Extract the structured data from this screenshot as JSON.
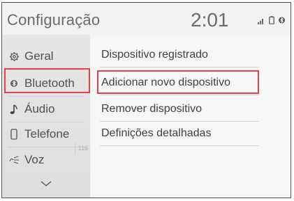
{
  "header": {
    "title": "Configuração",
    "clock": "2:01",
    "status_icons": [
      "signal-icon",
      "battery-icon",
      "bluetooth-status-icon"
    ]
  },
  "sidebar": {
    "items": [
      {
        "label": "Geral",
        "icon": "gear-icon"
      },
      {
        "label": "Bluetooth",
        "icon": "bluetooth-icon",
        "selected": true
      },
      {
        "label": "Áudio",
        "icon": "music-note-icon"
      },
      {
        "label": "Telefone",
        "icon": "phone-icon"
      },
      {
        "label": "Voz",
        "icon": "voice-icon"
      }
    ],
    "badge": "116",
    "more_icon": "chevron-down-icon"
  },
  "main": {
    "items": [
      {
        "label": "Dispositivo registrado"
      },
      {
        "label": "Adicionar novo dispositivo",
        "highlighted": true
      },
      {
        "label": "Remover dispositivo"
      },
      {
        "label": "Definições detalhadas"
      }
    ]
  },
  "colors": {
    "highlight": "#e0424b",
    "text": "#505050",
    "background": "#f2f2f2"
  }
}
